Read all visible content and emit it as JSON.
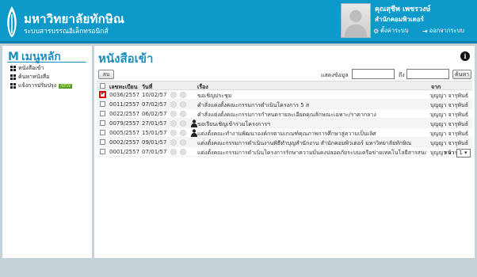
{
  "header": {
    "org_name": "มหาวิทยาลัยทักษิณ",
    "system_name": "ระบบสารบรรณอิเล็กทรอนิกส์",
    "user_name": "คุณสุชีพ เพชรวงษ์",
    "user_dept": "สำนักคอมพิวเตอร์",
    "settings_label": "ตั้งค่าระบบ",
    "logout_label": "ออกจากระบบ",
    "bg_color": "#0d99c9"
  },
  "sidebar": {
    "title_icon": "M",
    "title": "เมนูหลัก",
    "items": [
      {
        "label": "หนังสือเข้า"
      },
      {
        "label": "ค้นหาหนังสือ"
      },
      {
        "label": "แจ้งการปรับปรุง",
        "badge": "NEW"
      }
    ]
  },
  "main": {
    "title": "หนังสือเข้า",
    "delete_label": "ลบ",
    "filter_label": "แสดงข้อมูล",
    "filter_to": "ถึง",
    "search_label": "ค้นหา",
    "columns": {
      "number": "เลขทะเบียน",
      "date": "วันที่",
      "subject": "เรื่อง",
      "from": "จาก"
    },
    "rows": [
      {
        "checked": true,
        "number": "0036/2557",
        "date": "10/02/57",
        "subject": "ขอเชิญประชุม",
        "from": "บุญญา จารุพันธ์",
        "person": false
      },
      {
        "checked": false,
        "number": "0011/2557",
        "date": "07/02/57",
        "subject": "คำสั่งแต่งตั้งคณะกรรมการดำเนินโครงการ 5 ส",
        "from": "บุญญา จารุพันธ์",
        "person": false
      },
      {
        "checked": false,
        "number": "0022/2557",
        "date": "06/02/57",
        "subject": "คำสั่งแต่งตั้งคณะกรรมการกำหนดรายละเอียดคุณลักษณะเฉพาะ/ราคากลาง",
        "from": "บุญญา จารุพันธ์",
        "person": false
      },
      {
        "checked": false,
        "number": "0079/2557",
        "date": "27/01/57",
        "subject": "ขอเรียนเชิญเข้าร่วมโครงการฯ",
        "from": "บุญญา จารุพันธ์",
        "person": true
      },
      {
        "checked": false,
        "number": "0005/2557",
        "date": "15/01/57",
        "subject": "แต่งตั้งคณะทำงานพัฒนาองค์กรตามเกณฑ์คุณภาพการศึกษาสู่ความเป็นเลิศ",
        "from": "บุญญา จารุพันธ์",
        "person": true
      },
      {
        "checked": false,
        "number": "0002/2557",
        "date": "09/01/57",
        "subject": "แต่งตั้งคณะกรรมการดำเนินงานพิธีทำบุญสำนักงาน สำนักคอมพิวเตอร์ มหาวิทยาลัยทักษิณ",
        "from": "บุญญา จารุพันธ์",
        "person": false
      },
      {
        "checked": false,
        "number": "0001/2557",
        "date": "07/01/57",
        "subject": "แต่งตั้งคณะกรรมการดำเนินโครงการรักษาความมั่นคงปลอดภัยระบบเครือข่ายเทคโนโลยีสารสนเทศ",
        "from": "บุญญา จารุพันธ์",
        "person": false
      }
    ],
    "pager_label": "หน้า",
    "page": "1"
  },
  "colors": {
    "accent": "#1a8fc0",
    "page_bg": "#c6d2d7"
  }
}
